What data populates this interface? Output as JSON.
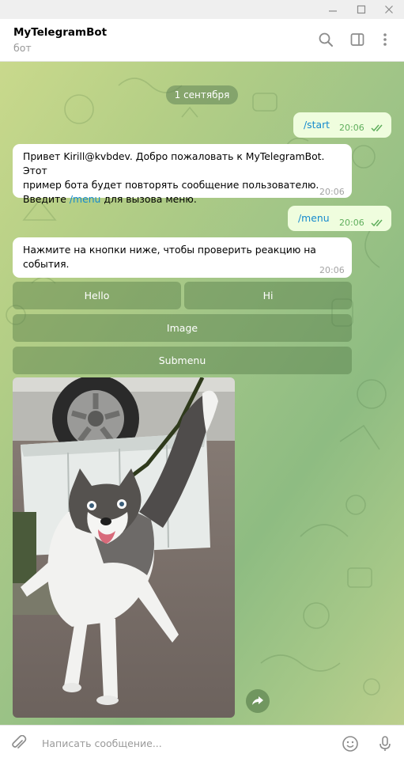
{
  "window": {
    "minimize_icon": "minimize-icon",
    "maximize_icon": "maximize-icon",
    "close_icon": "close-icon"
  },
  "header": {
    "title": "MyTelegramBot",
    "subtitle": "бот",
    "icons": [
      "search-icon",
      "sidebar-toggle-icon",
      "more-vertical-icon"
    ]
  },
  "chat": {
    "date_label": "1 сентября",
    "messages": [
      {
        "direction": "out",
        "text": "/start",
        "time": "20:06",
        "status": "read"
      },
      {
        "direction": "in",
        "text_line1": "Привет Kirill@kvbdev. Добро пожаловать к MyTelegramBot. Этот",
        "text_line2": "пример бота будет повторять сообщение пользователю.",
        "text_line3_prefix": "Введите ",
        "text_line3_link": "/menu",
        "text_line3_suffix": " для вызова меню.",
        "time": "20:06"
      },
      {
        "direction": "out",
        "text": "/menu",
        "time": "20:06",
        "status": "read"
      },
      {
        "direction": "in",
        "text_line1": "Нажмите на кнопки ниже, чтобы проверить реакцию на",
        "text_line2": "события.",
        "time": "20:06"
      }
    ],
    "keyboard": {
      "row1": [
        "Hello",
        "Hi"
      ],
      "row2": [
        "Image"
      ],
      "row3": [
        "Submenu"
      ]
    },
    "photo": {
      "alt": "",
      "share_icon": "share-arrow-icon"
    }
  },
  "input": {
    "placeholder": "Написать сообщение...",
    "icons": [
      "attach-icon",
      "emoji-icon",
      "microphone-icon"
    ]
  },
  "colors": {
    "accent": "#168acd",
    "outgoing_bubble": "#effdde",
    "checkmark": "#5fae5c",
    "keyboard_button": "#6f9a5e"
  }
}
